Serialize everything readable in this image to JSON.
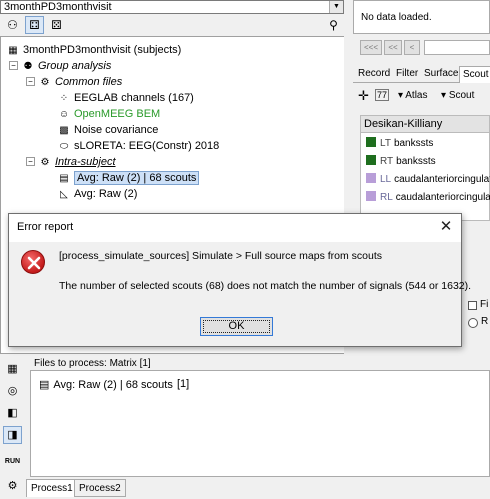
{
  "protocol": {
    "name": "3monthPD3monthvisit"
  },
  "tree": {
    "root": "3monthPD3monthvisit (subjects)",
    "group_analysis": "Group analysis",
    "common_files": "Common files",
    "eeglab_channels": "EEGLAB channels (167)",
    "openmeeg": "OpenMEEG BEM",
    "noise_cov": "Noise covariance",
    "sloreta": "sLORETA: EEG(Constr) 2018",
    "intra_subject": "Intra-subject",
    "avg_raw_scouts": "Avg: Raw (2) | 68 scouts",
    "avg_raw": "Avg: Raw (2)"
  },
  "right": {
    "no_data": "No data loaded.",
    "nav_buttons": [
      "<<<",
      "<<",
      "<"
    ],
    "tabs": [
      "Record",
      "Filter",
      "Surface",
      "Scout"
    ],
    "atlas_menu": "Atlas",
    "scout_menu": "Scout",
    "atlas_name": "Desikan-Killiany",
    "scouts": [
      {
        "hemi": "LT",
        "name": "bankssts",
        "color": "#1e6e1e"
      },
      {
        "hemi": "RT",
        "name": "bankssts",
        "color": "#1e6e1e"
      },
      {
        "hemi": "LL",
        "name": "caudalanteriorcingulate",
        "color": "#b89ed8"
      },
      {
        "hemi": "RL",
        "name": "caudalanteriorcingulate",
        "color": "#b89ed8"
      }
    ]
  },
  "dialog": {
    "title": "Error report",
    "line1": "[process_simulate_sources]  Simulate > Full source maps from scouts",
    "line2": "The number of selected scouts (68) does not match the number of signals (544 or 1632).",
    "ok": "OK",
    "error_color": "#c41b1b"
  },
  "process": {
    "files_label": "Files to process: Matrix [1]",
    "file_name": "Avg: Raw (2) | 68 scouts",
    "file_count": "[1]",
    "run_label": "RUN",
    "tabs": [
      "Process1",
      "Process2"
    ]
  },
  "behind": {
    "f_label": "Fi",
    "r_label": "R"
  }
}
